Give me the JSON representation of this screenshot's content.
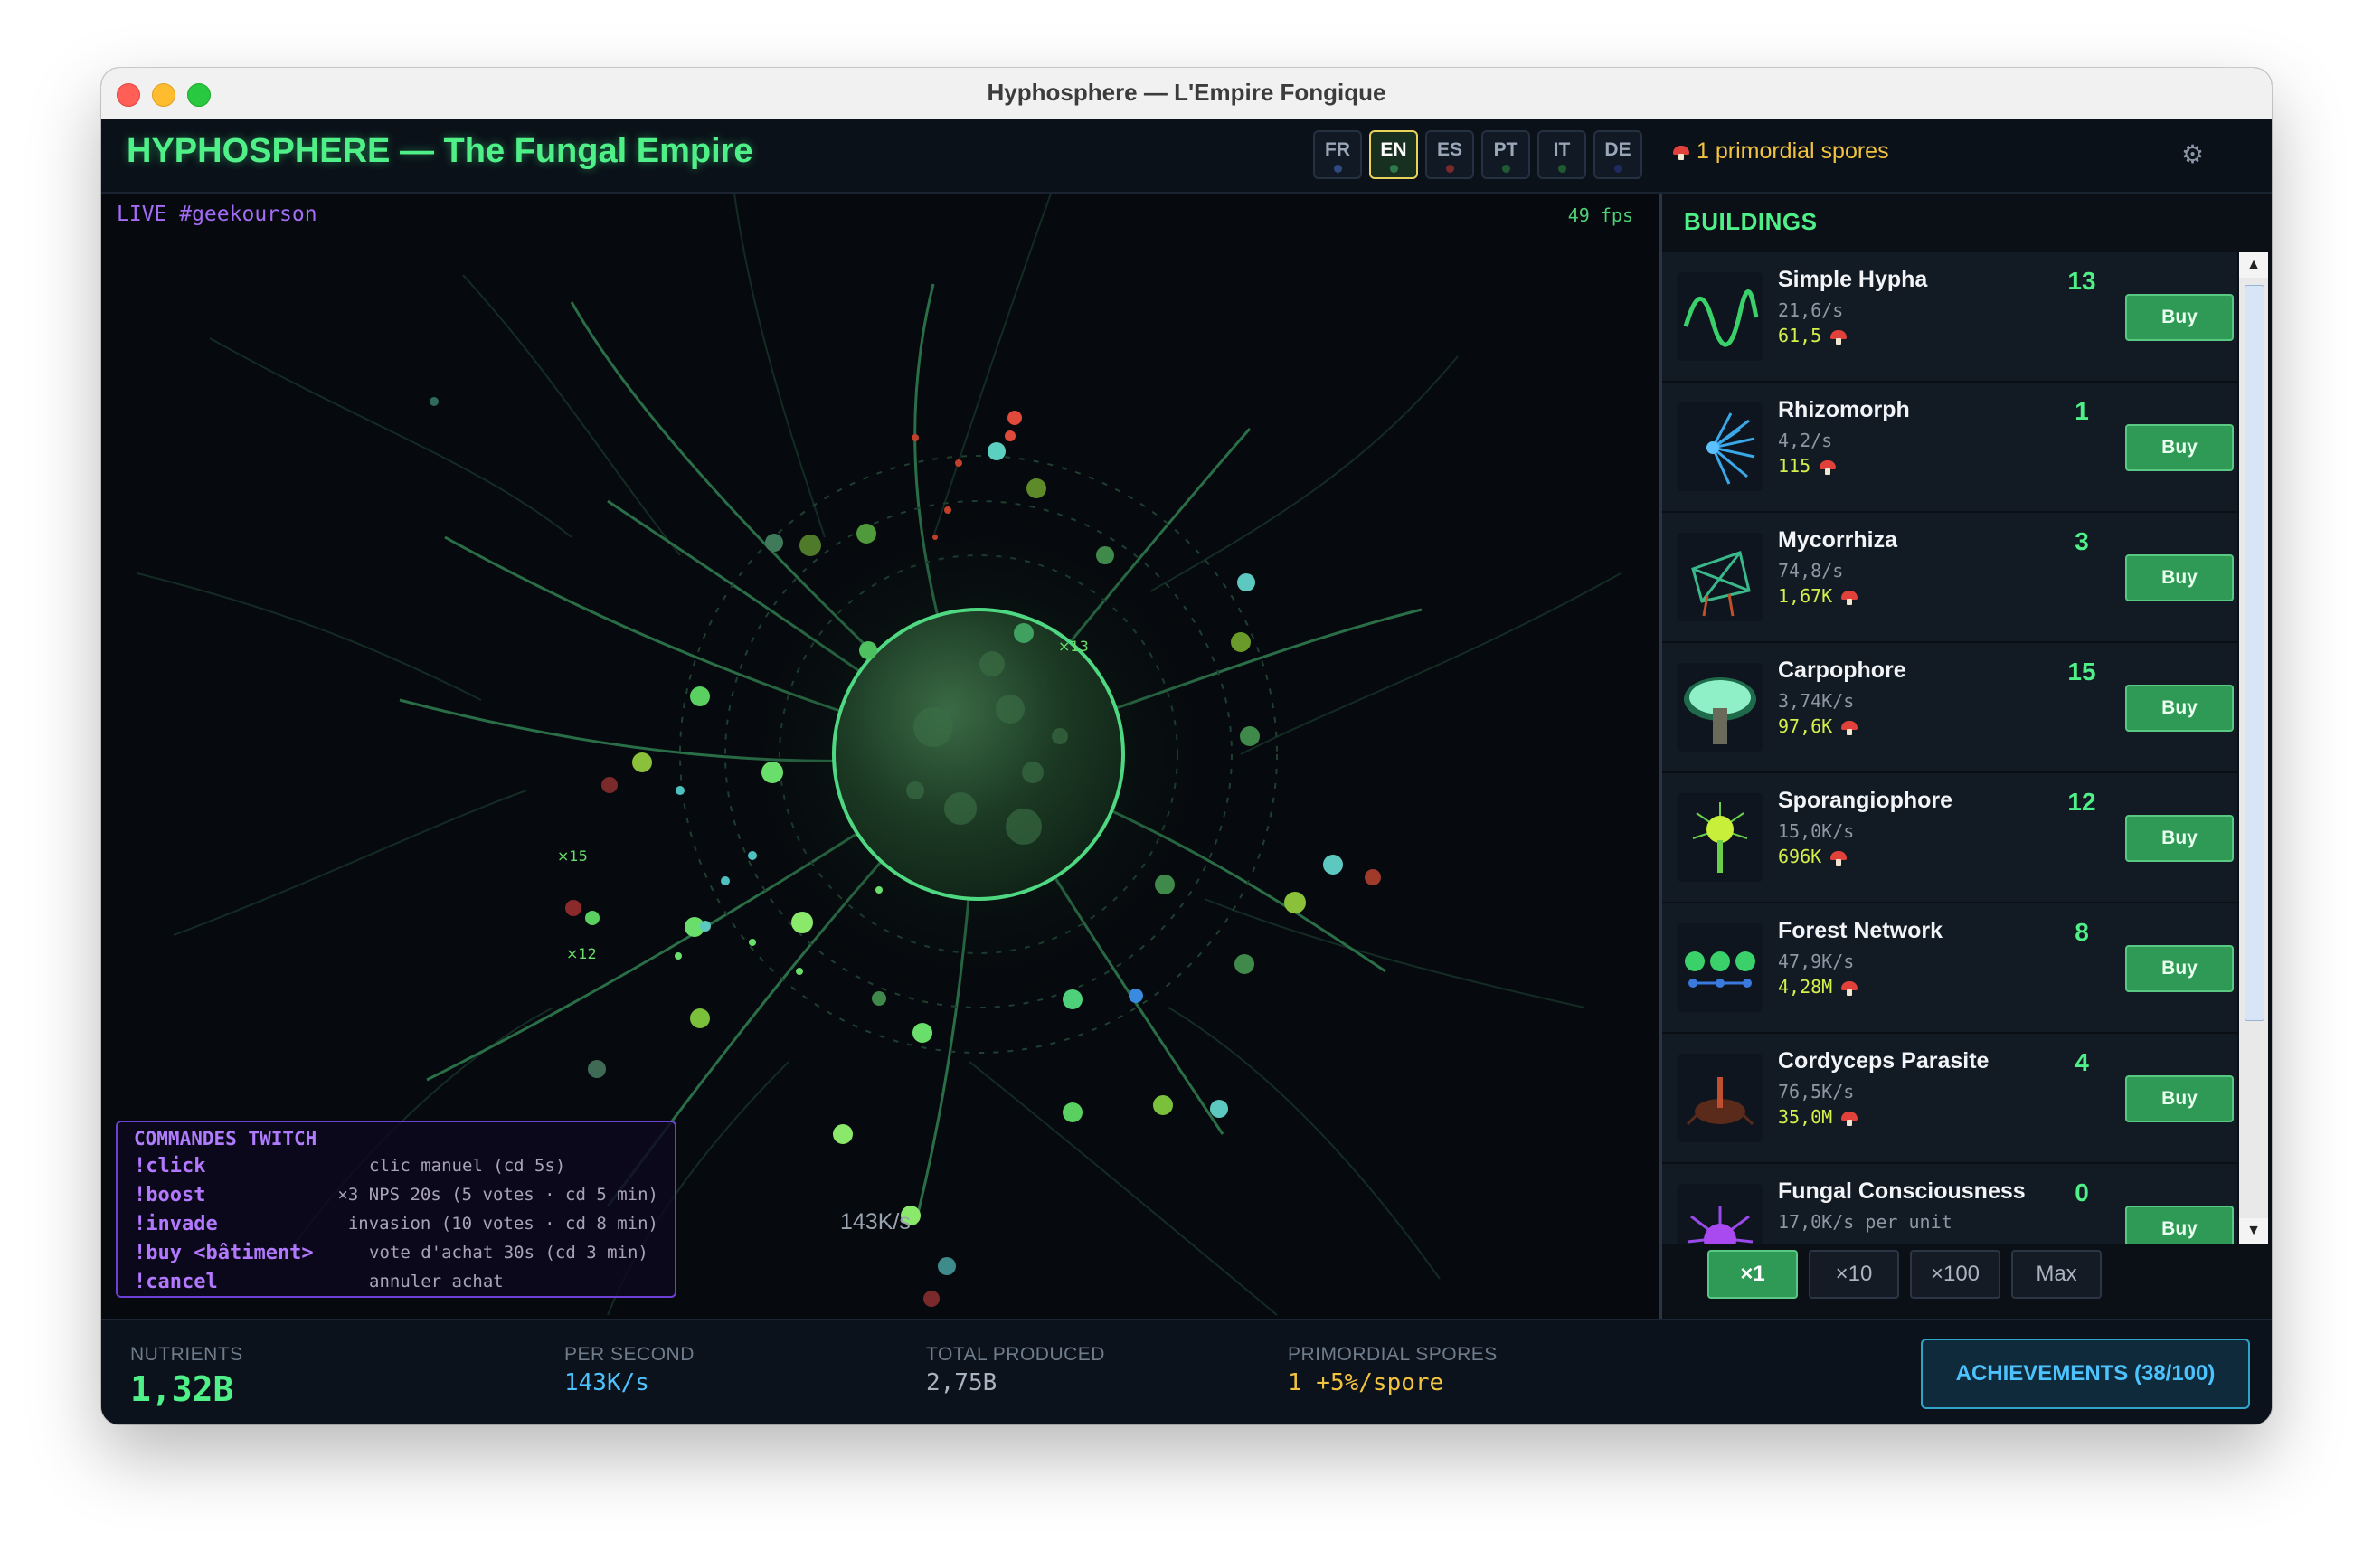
{
  "window": {
    "title": "Hyphosphere — L'Empire Fongique"
  },
  "header": {
    "game_title": "HYPHOSPHERE — The Fungal Empire",
    "languages": [
      {
        "code": "FR",
        "dot_color": "#2e4a80",
        "active": false
      },
      {
        "code": "EN",
        "dot_color": "#2e7a4a",
        "active": true
      },
      {
        "code": "ES",
        "dot_color": "#7a2a2a",
        "active": false
      },
      {
        "code": "PT",
        "dot_color": "#1f5a30",
        "active": false
      },
      {
        "code": "IT",
        "dot_color": "#1f5a30",
        "active": false
      },
      {
        "code": "DE",
        "dot_color": "#1e2a60",
        "active": false
      }
    ],
    "spores_text": "1 primordial spores",
    "settings_icon": "gear-icon"
  },
  "game": {
    "live_label": "LIVE #geekourson",
    "fps": "49 fps",
    "per_second": "143K/s",
    "multiplier_labels": [
      "×13",
      "×15",
      "×12"
    ]
  },
  "twitch": {
    "title": "COMMANDES TWITCH",
    "commands": [
      {
        "cmd": "!click",
        "desc": "clic manuel  (cd 5s)"
      },
      {
        "cmd": "!boost",
        "desc": "×3 NPS 20s  (5 votes · cd 5 min)"
      },
      {
        "cmd": "!invade",
        "desc": "invasion  (10 votes · cd 8 min)"
      },
      {
        "cmd": "!buy <bâtiment>",
        "desc": "vote d'achat 30s  (cd 3 min)"
      },
      {
        "cmd": "!cancel",
        "desc": "annuler achat"
      }
    ]
  },
  "buildings": {
    "title": "BUILDINGS",
    "buy_label": "Buy",
    "items": [
      {
        "name": "Simple Hypha",
        "rate": "21,6/s",
        "cost": "61,5",
        "count": "13",
        "icon": "hypha-icon"
      },
      {
        "name": "Rhizomorph",
        "rate": "4,2/s",
        "cost": "115",
        "count": "1",
        "icon": "rhizomorph-icon"
      },
      {
        "name": "Mycorrhiza",
        "rate": "74,8/s",
        "cost": "1,67K",
        "count": "3",
        "icon": "mycorrhiza-icon"
      },
      {
        "name": "Carpophore",
        "rate": "3,74K/s",
        "cost": "97,6K",
        "count": "15",
        "icon": "mushroom-icon"
      },
      {
        "name": "Sporangiophore",
        "rate": "15,0K/s",
        "cost": "696K",
        "count": "12",
        "icon": "sporangiophore-icon"
      },
      {
        "name": "Forest Network",
        "rate": "47,9K/s",
        "cost": "4,28M",
        "count": "8",
        "icon": "network-icon"
      },
      {
        "name": "Cordyceps Parasite",
        "rate": "76,5K/s",
        "cost": "35,0M",
        "count": "4",
        "icon": "cordyceps-icon"
      },
      {
        "name": "Fungal Consciousness",
        "rate": "17,0K/s per unit",
        "cost": "",
        "count": "0",
        "icon": "consciousness-icon"
      }
    ],
    "multipliers": [
      "×1",
      "×10",
      "×100",
      "Max"
    ]
  },
  "stats": {
    "nutrients_label": "NUTRIENTS",
    "nutrients_value": "1,32B",
    "per_second_label": "PER SECOND",
    "per_second_value": "143K/s",
    "total_label": "TOTAL PRODUCED",
    "total_value": "2,75B",
    "primordial_label": "PRIMORDIAL SPORES",
    "primordial_value": "1 +5%/spore",
    "achievements_label": "ACHIEVEMENTS (38/100)"
  },
  "colors": {
    "accent": "#4ff088",
    "twitch": "#a36cf5",
    "spores": "#f2c340",
    "cost": "#d4f04b",
    "per_second": "#4cc3ff"
  }
}
